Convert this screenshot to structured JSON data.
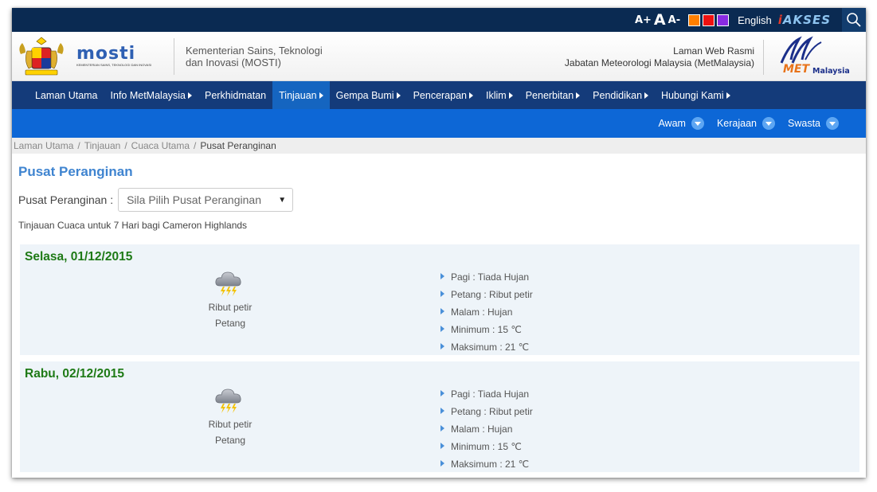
{
  "topbar": {
    "font_increase": "A+",
    "font_normal": "A",
    "font_decrease": "A-",
    "theme_colors": [
      "#ff7f00",
      "#ee1111",
      "#8a2be2"
    ],
    "language": "English",
    "akses_prefix": "i",
    "akses_label": "AKSES",
    "search_icon": "search-icon"
  },
  "header": {
    "mosti_wordmark": "mosti",
    "mosti_subtext": "KEMENTERIAN SAINS, TEKNOLOGI DAN INOVASI",
    "ministry_line1": "Kementerian Sains, Teknologi",
    "ministry_line2": "dan Inovasi (MOSTI)",
    "official_line1": "Laman Web Rasmi",
    "official_line2": "Jabatan Meteorologi Malaysia (MetMalaysia)",
    "met_logo_text_met": "MET",
    "met_logo_text_malaysia": "Malaysia"
  },
  "nav": {
    "items": [
      {
        "label": "Laman Utama",
        "has_caret": false,
        "active": false
      },
      {
        "label": "Info MetMalaysia",
        "has_caret": true,
        "active": false
      },
      {
        "label": "Perkhidmatan",
        "has_caret": false,
        "active": false
      },
      {
        "label": "Tinjauan",
        "has_caret": true,
        "active": true
      },
      {
        "label": "Gempa Bumi",
        "has_caret": true,
        "active": false
      },
      {
        "label": "Pencerapan",
        "has_caret": true,
        "active": false
      },
      {
        "label": "Iklim",
        "has_caret": true,
        "active": false
      },
      {
        "label": "Penerbitan",
        "has_caret": true,
        "active": false
      },
      {
        "label": "Pendidikan",
        "has_caret": true,
        "active": false
      },
      {
        "label": "Hubungi Kami",
        "has_caret": true,
        "active": false
      }
    ]
  },
  "subnav": {
    "items": [
      "Awam",
      "Kerajaan",
      "Swasta"
    ]
  },
  "breadcrumb": {
    "items": [
      "Laman Utama",
      "Tinjauan",
      "Cuaca Utama"
    ],
    "current": "Pusat Peranginan"
  },
  "main": {
    "title": "Pusat Peranginan",
    "select_label": "Pusat Peranginan :",
    "select_value": "Sila Pilih Pusat Peranginan",
    "subtitle": "Tinjauan Cuaca untuk 7 Hari bagi Cameron Highlands",
    "days": [
      {
        "date": "Selasa, 01/12/2015",
        "icon": "thunderstorm-icon",
        "condition": "Ribut petir",
        "period": "Petang",
        "details": [
          "Pagi : Tiada Hujan",
          "Petang : Ribut petir",
          "Malam : Hujan",
          "Minimum : 15 ℃",
          "Maksimum : 21 ℃"
        ]
      },
      {
        "date": "Rabu, 02/12/2015",
        "icon": "thunderstorm-icon",
        "condition": "Ribut petir",
        "period": "Petang",
        "details": [
          "Pagi : Tiada Hujan",
          "Petang : Ribut petir",
          "Malam : Hujan",
          "Minimum : 15 ℃",
          "Maksimum : 21 ℃"
        ]
      }
    ]
  }
}
